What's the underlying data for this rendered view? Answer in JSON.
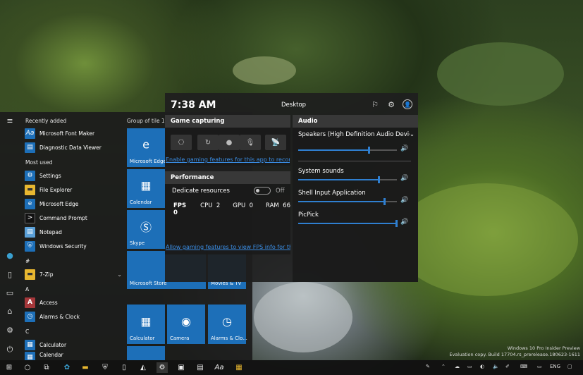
{
  "start_menu": {
    "recently_added_header": "Recently added",
    "recently_added": [
      {
        "label": "Microsoft Font Maker",
        "icon": "font-maker-icon"
      },
      {
        "label": "Diagnostic Data Viewer",
        "icon": "diagnostic-icon"
      }
    ],
    "most_used_header": "Most used",
    "most_used": [
      {
        "label": "Settings",
        "icon": "gear-icon"
      },
      {
        "label": "File Explorer",
        "icon": "folder-icon"
      },
      {
        "label": "Microsoft Edge",
        "icon": "edge-icon"
      },
      {
        "label": "Command Prompt",
        "icon": "cmd-icon"
      },
      {
        "label": "Notepad",
        "icon": "notepad-icon"
      },
      {
        "label": "Windows Security",
        "icon": "shield-icon"
      }
    ],
    "letter_hash": "#",
    "hash_apps": [
      {
        "label": "7-Zip",
        "icon": "folder-icon"
      }
    ],
    "letter_a": "A",
    "a_apps": [
      {
        "label": "Access",
        "icon": "access-icon"
      },
      {
        "label": "Alarms & Clock",
        "icon": "alarm-icon"
      }
    ],
    "letter_c": "C",
    "c_apps": [
      {
        "label": "Calculator",
        "icon": "calculator-icon"
      },
      {
        "label": "Calendar",
        "icon": "calendar-icon"
      }
    ],
    "tile_group": "Group of tile 1",
    "tiles": [
      {
        "label": "Microsoft Edge",
        "icon": "edge-icon"
      },
      {
        "label": "Calendar",
        "icon": "calendar-icon"
      },
      {
        "label": "Skype",
        "icon": "skype-icon"
      },
      {
        "label": "Microsoft Store",
        "icon": "store-icon"
      },
      {
        "label": "Movies & TV",
        "icon": "movies-icon"
      },
      {
        "label": "Calculator",
        "icon": "calculator-icon"
      },
      {
        "label": "Camera",
        "icon": "camera-icon"
      },
      {
        "label": "Alarms & Clo...",
        "icon": "alarm-icon"
      }
    ]
  },
  "game_bar": {
    "time": "7:38 AM",
    "context": "Desktop",
    "capture": {
      "title": "Game capturing",
      "link": "Enable gaming features for this app to record g"
    },
    "performance": {
      "title": "Performance",
      "dedicate_label": "Dedicate resources",
      "toggle_state": "Off",
      "fps_label": "FPS 0",
      "cpu_label": "CPU",
      "cpu_value": "2",
      "gpu_label": "GPU",
      "gpu_value": "0",
      "ram_label": "RAM",
      "ram_value": "66",
      "link": "Allow gaming features to view FPS info for this"
    },
    "audio": {
      "title": "Audio",
      "device": "Speakers (High Definition Audio Devic",
      "device_level": 0.72,
      "apps": [
        {
          "name": "System sounds",
          "level": 0.82
        },
        {
          "name": "Shell Input Application",
          "level": 0.88
        },
        {
          "name": "PicPick",
          "level": 1.0
        }
      ]
    }
  },
  "watermark": {
    "line1": "Windows 10 Pro Insider Preview",
    "line2": "Evaluation copy. Build 17704.rs_prerelease.180623-1611"
  },
  "taskbar": {
    "language": "ENG"
  },
  "colors": {
    "accent": "#1d6fb8",
    "link": "#3a8ee6"
  }
}
